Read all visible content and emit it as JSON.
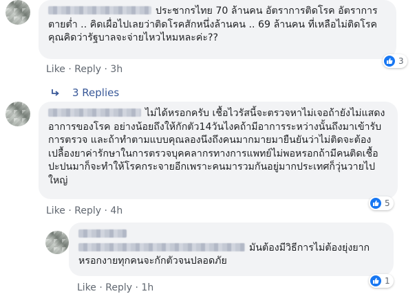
{
  "comments": [
    {
      "text": "ประชากรไทย 70 ล้านคน อัตราการติดโรค อัตราการตายต่ำ .. คิดเผื่อไปเลยว่าติดโรคสักหนึ่งล้านคน .. 69 ล้านคน ที่เหลือไม่ติดโรค คุณคิดว่ารัฐบาลจะจ่ายไหวไหมหละค่ะ??",
      "like": "Like",
      "reply": "Reply",
      "sep": "·",
      "time": "3h",
      "reaction_count": "3"
    },
    {
      "text": "ไม่ได้หรอกครับ เชื้อไวรัสนี้จะตรวจหาไม่เจอถ้ายังไม่แสดงอาการของโรค อย่างน้อยถึงให้กักตัว14วันไงคถ้ามีอาการระหว่างนั้นถึงมาเข้ารับการตรวจ และถ้าทำตามแบบคุณลองนึงถึงคนมากมายมายืนยันว่าไม่ติดจะต้องเปลื้องยาค่ารักษาในการตรวจบุคคลากรทางการแพทย์ไม่พอหรอกถ้ามีคนติดเชื้อปะปนมาก็จะทำให้โรคกระจายอีกเพราะคนมารวมกันอยู่มากประเทศก็วุ่นวายไปใหญ่",
      "like": "Like",
      "reply": "Reply",
      "sep": "·",
      "time": "4h",
      "reaction_count": "5"
    },
    {
      "text": "มันต้องมีวิธีการไม่ต้องยุ่งยากหรอกงายทุกคนจะกักตัวจนปลอดภัย",
      "like": "Like",
      "reply": "Reply",
      "sep": "·",
      "time": "1h",
      "reaction_count": "1"
    }
  ],
  "replies_label": "3 Replies",
  "icons": {
    "reaction": "like-icon",
    "replies": "reply-arrow-icon"
  },
  "colors": {
    "like": "#1877f2",
    "bubble": "#f2f3f5",
    "link": "#385898"
  }
}
